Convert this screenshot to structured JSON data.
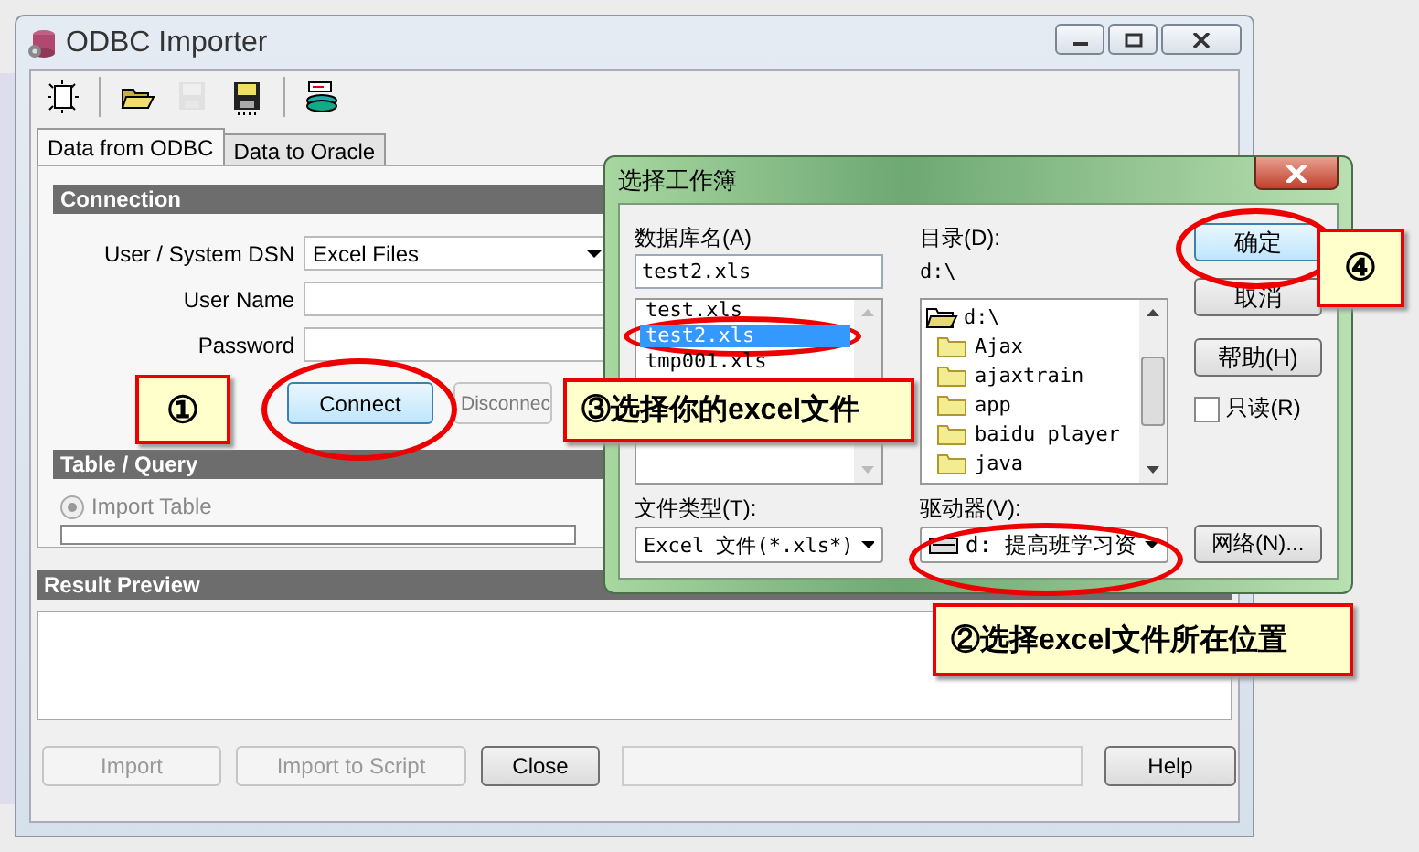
{
  "main_window": {
    "title": "ODBC Importer",
    "toolbar": [
      {
        "kind": "new",
        "disabled": false
      },
      {
        "kind": "open",
        "disabled": false
      },
      {
        "kind": "save",
        "disabled": true
      },
      {
        "kind": "save-as",
        "disabled": false
      },
      {
        "kind": "database",
        "disabled": false
      }
    ],
    "tabs": [
      {
        "label": "Data from ODBC",
        "selected": true
      },
      {
        "label": "Data to Oracle",
        "selected": false
      }
    ],
    "connection": {
      "header": "Connection",
      "dsn_label": "User / System DSN",
      "dsn_value": "Excel Files",
      "user_label": "User Name",
      "password_label": "Password",
      "buttons": [
        {
          "label": "Connect",
          "disabled": false
        },
        {
          "label": "Disconnec",
          "disabled": true
        }
      ]
    },
    "table_query": {
      "header": "Table / Query",
      "radio_label": "Import Table",
      "radio_selected": true,
      "radio_disabled": true
    },
    "result_preview": {
      "header": "Result Preview"
    },
    "bottom_bar": [
      {
        "kind": "button",
        "label": "Import",
        "disabled": true
      },
      {
        "kind": "button",
        "label": "Import to Script",
        "disabled": true
      },
      {
        "kind": "button",
        "label": "Close",
        "disabled": false
      },
      {
        "kind": "field"
      },
      {
        "kind": "button",
        "label": "Help",
        "disabled": false
      }
    ]
  },
  "dialog": {
    "title": "选择工作簿",
    "db_label": "数据库名(A)",
    "db_value": "test2.xls",
    "files": [
      {
        "name": "test.xls",
        "selected": false
      },
      {
        "name": "test2.xls",
        "selected": true
      },
      {
        "name": "tmp001.xls",
        "selected": false
      }
    ],
    "type_label": "文件类型(T):",
    "type_value": "Excel 文件(*.xls*)",
    "dir_label": "目录(D):",
    "dir_path": "d:\\",
    "folders": [
      {
        "name": "d:\\",
        "kind": "open"
      },
      {
        "name": "Ajax",
        "kind": "closed"
      },
      {
        "name": "ajaxtrain",
        "kind": "closed"
      },
      {
        "name": "app",
        "kind": "closed"
      },
      {
        "name": "baidu player",
        "kind": "closed"
      },
      {
        "name": "java",
        "kind": "closed"
      }
    ],
    "drive_label": "驱动器(V):",
    "drive_value": "d: 提高班学习资",
    "buttons": [
      {
        "label": "确定",
        "default": true
      },
      {
        "label": "取消",
        "default": false
      },
      {
        "label": "帮助(H)",
        "default": false
      }
    ],
    "readonly": {
      "label": "只读(R)",
      "checked": false
    },
    "network": "网络(N)..."
  },
  "callouts": [
    {
      "text": "①"
    },
    {
      "text": "③选择你的excel文件"
    },
    {
      "text": "④"
    },
    {
      "text": "②选择excel文件所在位置"
    }
  ]
}
